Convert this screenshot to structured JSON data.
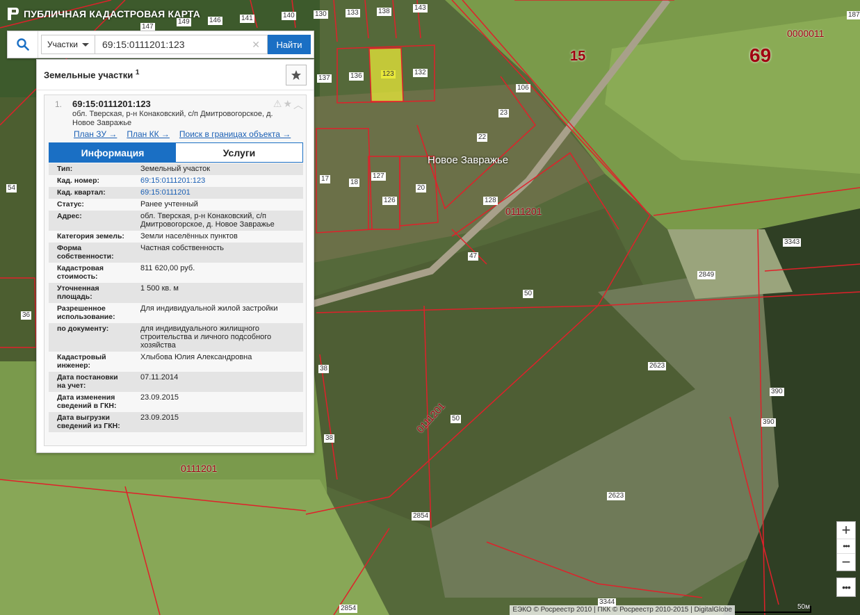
{
  "app": {
    "title": "ПУБЛИЧНАЯ КАДАСТРОВАЯ КАРТА"
  },
  "search": {
    "type_label": "Участки",
    "query": "69:15:0111201:123",
    "find_label": "Найти"
  },
  "panel": {
    "title": "Земельные участки",
    "count": "1",
    "item": {
      "index": "1.",
      "cad_number": "69:15:0111201:123",
      "address": "обл. Тверская, р-н Конаковский, с/п Дмитровогорское, д. Новое Завражье",
      "links": [
        "План ЗУ →",
        "План КК →",
        "Поиск в границах объекта →"
      ]
    },
    "tabs": [
      "Информация",
      "Услуги"
    ],
    "rows": [
      {
        "k": "Тип:",
        "v": "Земельный участок"
      },
      {
        "k": "Кад. номер:",
        "v": "69:15:0111201:123",
        "link": true
      },
      {
        "k": "Кад. квартал:",
        "v": "69:15:0111201",
        "link": true
      },
      {
        "k": "Статус:",
        "v": "Ранее учтенный"
      },
      {
        "k": "Адрес:",
        "v": "обл. Тверская, р-н Конаковский, с/п Дмитровогорское, д. Новое Завражье"
      },
      {
        "k": "Категория земель:",
        "v": "Земли населённых пунктов"
      },
      {
        "k": "Форма собственности:",
        "v": "Частная собственность"
      },
      {
        "k": "Кадастровая стоимость:",
        "v": "811 620,00 руб."
      },
      {
        "k": "Уточненная площадь:",
        "v": "1 500 кв. м"
      },
      {
        "k": "Разрешенное использование:",
        "v": "Для индивидуальной жилой застройки"
      },
      {
        "k": "по документу:",
        "v": "для индивидуального жилищного строительства и личного подсобного хозяйства"
      },
      {
        "k": "Кадастровый инженер:",
        "v": "Хлыбова Юлия Александровна"
      },
      {
        "k": "Дата постановки на учет:",
        "v": "07.11.2014"
      },
      {
        "k": "Дата изменения сведений в ГКН:",
        "v": "23.09.2015"
      },
      {
        "k": "Дата выгрузки сведений из ГКН:",
        "v": "23.09.2015"
      }
    ]
  },
  "map": {
    "village_name": "Новое Завражье",
    "big_labels": [
      "15",
      "69"
    ],
    "quarter_labels": [
      "0000011",
      "0111201",
      "0111201",
      "0111201"
    ],
    "parcel_labels": [
      "147",
      "149",
      "146",
      "141",
      "140",
      "130",
      "133",
      "138",
      "143",
      "137",
      "136",
      "123",
      "132",
      "106",
      "23",
      "22",
      "17",
      "18",
      "127",
      "126",
      "20",
      "128",
      "47",
      "50",
      "50",
      "38",
      "38",
      "54",
      "36",
      "3343",
      "2849",
      "2623",
      "2623",
      "2854",
      "2854",
      "390",
      "390",
      "3344",
      "187"
    ],
    "attribution": "ЕЭКО © Росреестр 2010 | ПКК © Росреестр 2010-2015 | DigitalGlobe",
    "scale_label": "50м",
    "colors": {
      "parcel_line": "#e0202a",
      "selected_fill": "#e8e83a",
      "accent": "#1a6fc4"
    }
  },
  "controls": {
    "zoom_in": "+",
    "zoom_mid": "•••",
    "zoom_out": "−",
    "more": "•••"
  }
}
